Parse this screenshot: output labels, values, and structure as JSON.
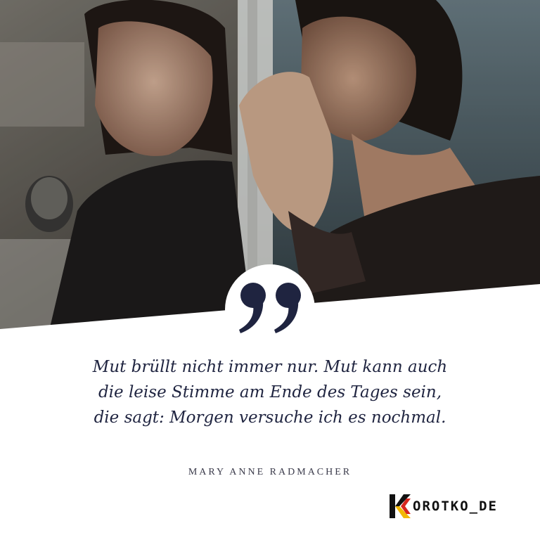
{
  "quote": {
    "lines": [
      "Mut brüllt nicht immer nur. Mut kann auch",
      "die leise Stimme am Ende des Tages sein,",
      "die sagt: Morgen versuche ich es nochmal."
    ],
    "author": "MARY ANNE RADMACHER"
  },
  "brand": {
    "logo_text": "OROTKO_DE",
    "colors": {
      "black": "#111111",
      "red": "#d7261e",
      "gold": "#f2b705"
    }
  },
  "colors": {
    "quote_text": "#1f2440",
    "quote_mark": "#1f2440",
    "panel": "#ffffff"
  },
  "icons": {
    "quote_mark": "double-quote-icon",
    "logo_mark": "korotko-k-logo-icon"
  }
}
